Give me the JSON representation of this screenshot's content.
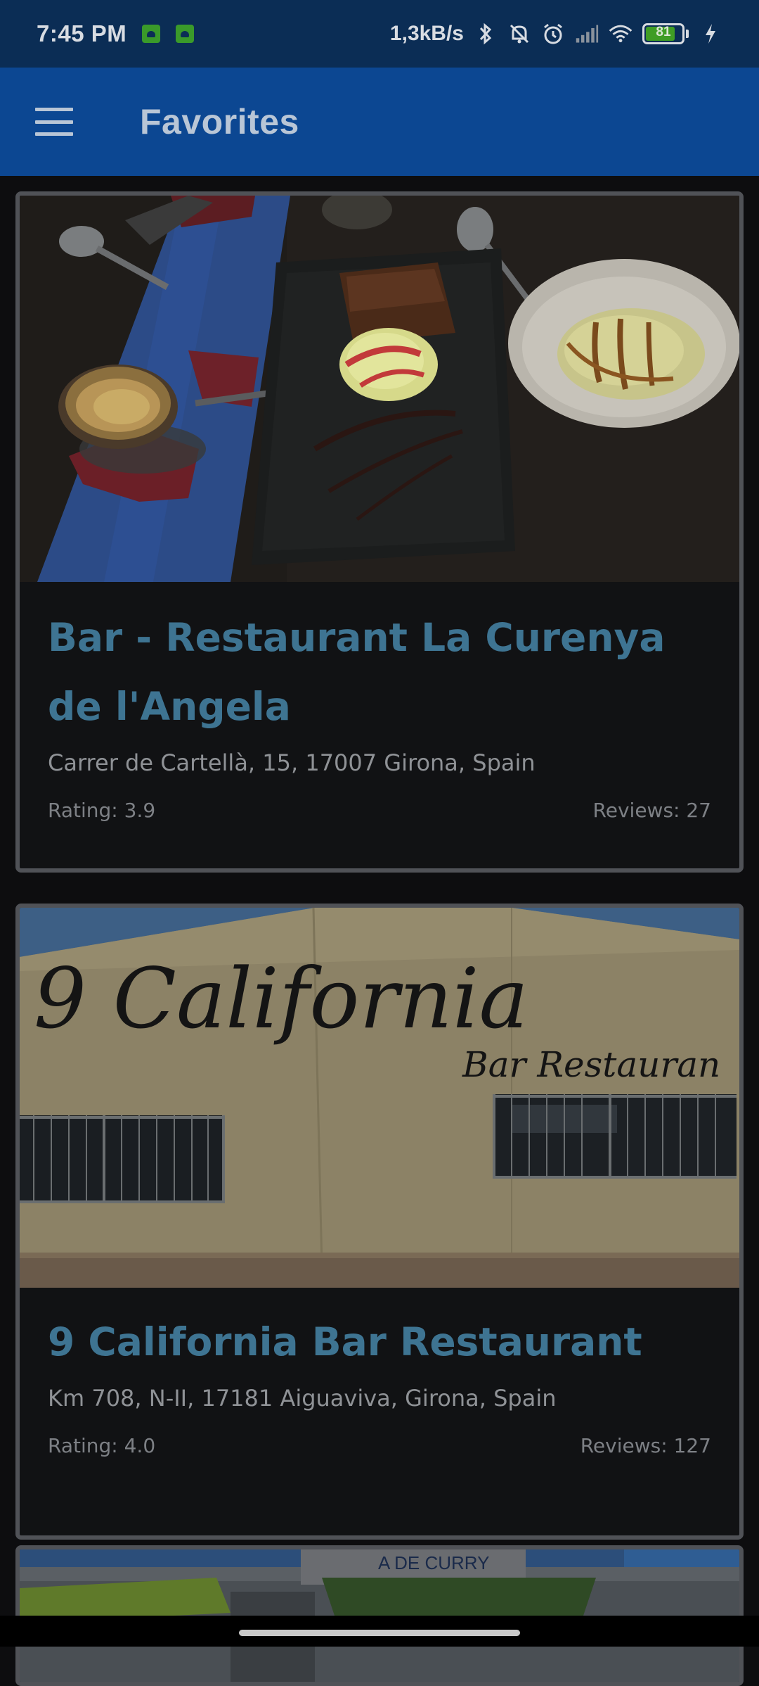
{
  "status_bar": {
    "time": "7:45 PM",
    "speed": "1,3kB/s",
    "battery": "81",
    "battery_level": 0.81,
    "icons": [
      "android-icon",
      "android-icon",
      "bluetooth-icon",
      "mute-icon",
      "alarm-icon",
      "signal-icon",
      "wifi-icon",
      "battery-icon",
      "charging-icon"
    ]
  },
  "app_bar": {
    "title": "Favorites",
    "menu_icon": "hamburger-menu-icon"
  },
  "favorites": [
    {
      "name": "Bar - Restaurant La Curenya de l'Angela",
      "address": "Carrer de Cartellà, 15, 17007 Girona, Spain",
      "rating": "Rating: 3.9",
      "reviews": "Reviews: 27",
      "image": "desserts-photo"
    },
    {
      "name": "9 California Bar Restaurant",
      "address": "Km 708, N-II, 17181 Aiguaviva, Girona, Spain",
      "rating": "Rating: 4.0",
      "reviews": "Reviews: 127",
      "image": "restaurant-facade-photo",
      "image_text_1": "9 California",
      "image_text_2": "Bar Restauran"
    },
    {
      "image": "storefront-photo",
      "image_text": "A DE CURRY"
    }
  ]
}
